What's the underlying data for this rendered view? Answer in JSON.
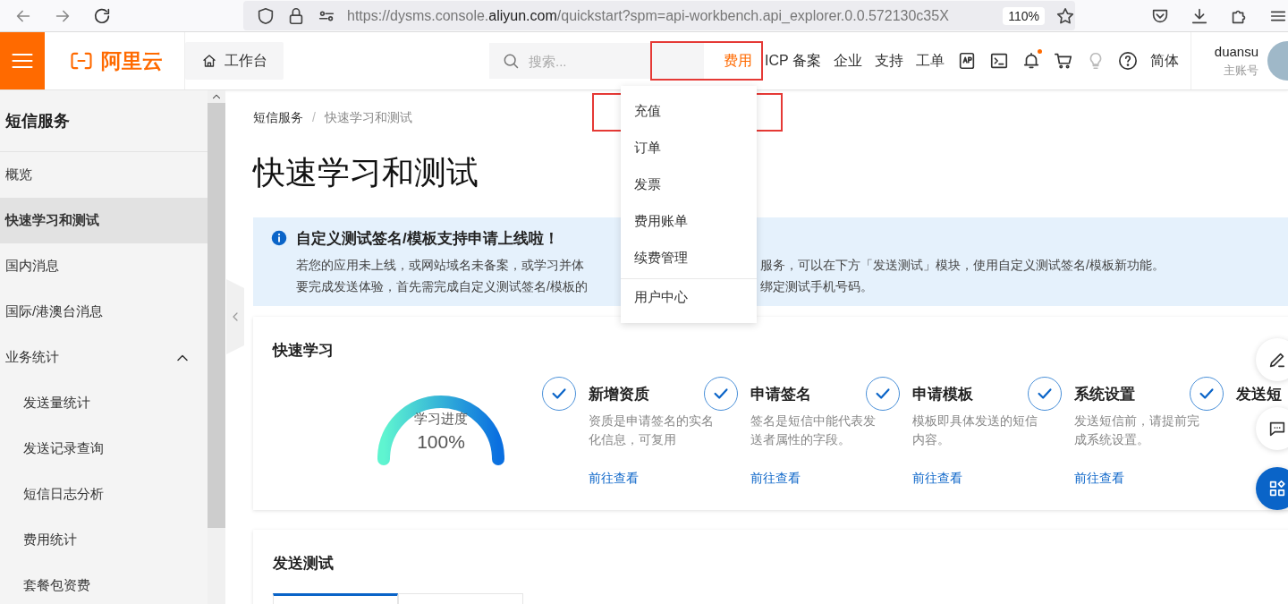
{
  "browser": {
    "url_host_prefix": "https://dysms.console.",
    "url_host": "aliyun.com",
    "url_rest": "/quickstart?spm=api-workbench.api_explorer.0.0.572130c35X",
    "zoom": "110%"
  },
  "header": {
    "logo": "阿里云",
    "workbench": "工作台",
    "search": {
      "placeholder": "搜索..."
    },
    "nav": [
      {
        "kind": "text",
        "label": "费用",
        "selected": true
      },
      {
        "kind": "text",
        "label": "ICP 备案",
        "selected": false
      },
      {
        "kind": "text",
        "label": "企业",
        "selected": false
      },
      {
        "kind": "text",
        "label": "支持",
        "selected": false
      },
      {
        "kind": "text",
        "label": "工单",
        "selected": false
      },
      {
        "kind": "app"
      },
      {
        "kind": "terminal"
      },
      {
        "kind": "bell"
      },
      {
        "kind": "cart"
      },
      {
        "kind": "bulb"
      },
      {
        "kind": "help"
      },
      {
        "kind": "text",
        "label": "简体",
        "selected": false
      }
    ],
    "user": {
      "name": "duansu",
      "role": "主账号"
    }
  },
  "sidebar": {
    "title": "短信服务",
    "items": [
      {
        "label": "概览",
        "selected": false
      },
      {
        "label": "快速学习和测试",
        "selected": true
      },
      {
        "label": "国内消息",
        "selected": false
      },
      {
        "label": "国际/港澳台消息",
        "selected": false
      },
      {
        "label": "业务统计",
        "selected": false,
        "expanded": true,
        "children": [
          {
            "label": "发送量统计",
            "selected": false
          },
          {
            "label": "发送记录查询",
            "selected": false
          },
          {
            "label": "短信日志分析",
            "selected": false
          },
          {
            "label": "费用统计",
            "selected": false
          },
          {
            "label": "套餐包资费",
            "selected": false
          }
        ]
      }
    ]
  },
  "breadcrumb": {
    "items": [
      "短信服务",
      "快速学习和测试"
    ],
    "separator": "/"
  },
  "page_title": "快速学习和测试",
  "notice": {
    "title": "自定义测试签名/模板支持申请上线啦！",
    "lines": [
      {
        "left": "若您的应用未上线，或网站域名未备案，或学习并体",
        "right": "服务，可以在下方「发送测试」模块，使用自定义测试签名/模板新功能。"
      },
      {
        "left": "要完成发送体验，首先需完成自定义测试签名/模板的",
        "right": "绑定测试手机号码。"
      }
    ]
  },
  "quick_learn": {
    "title": "快速学习",
    "progress": {
      "label": "学习进度",
      "value": "100%",
      "level": 1
    },
    "steps": [
      {
        "title": "新增资质",
        "done": true,
        "description": "资质是申请签名的实名化信息，可复用",
        "link": "前往查看"
      },
      {
        "title": "申请签名",
        "done": true,
        "description": "签名是短信中能代表发送者属性的字段。",
        "link": "前往查看"
      },
      {
        "title": "申请模板",
        "done": true,
        "description": "模板即具体发送的短信内容。",
        "link": "前往查看"
      },
      {
        "title": "系统设置",
        "done": true,
        "description": "发送短信前，请提前完成系统设置。",
        "link": "前往查看"
      },
      {
        "title": "发送短",
        "done": true
      }
    ]
  },
  "send_test": {
    "title": "发送测试",
    "tabs": [
      {
        "selected": true
      },
      {
        "selected": false
      }
    ]
  },
  "dropdown": {
    "items": [
      {
        "label": "充值"
      },
      {
        "label": "订单"
      },
      {
        "label": "发票"
      },
      {
        "label": "费用账单"
      },
      {
        "label": "续费管理"
      },
      {
        "label": "用户中心",
        "divider_above": true
      }
    ]
  },
  "annotations": [
    {
      "kind": "box"
    },
    {
      "kind": "box"
    }
  ]
}
